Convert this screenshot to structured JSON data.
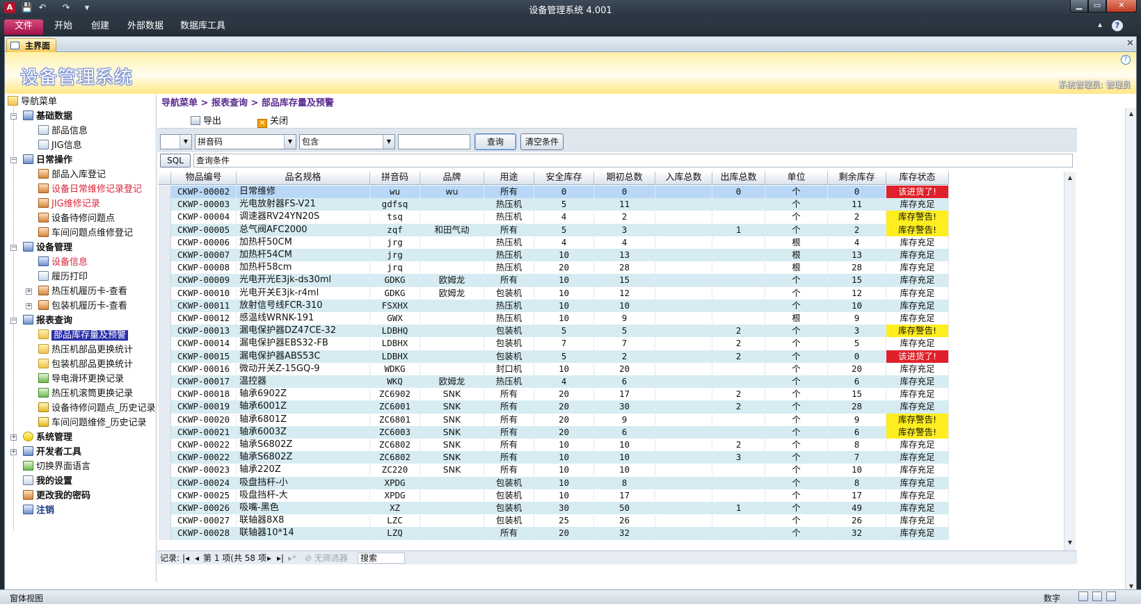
{
  "window": {
    "title": "设备管理系统 4.001",
    "min": "▁",
    "max": "▭",
    "close": "✕"
  },
  "quick_access": {
    "save": "💾",
    "undo": "↶",
    "redo": "↷",
    "more": "▾"
  },
  "ribbon": {
    "tabs": [
      "文件",
      "开始",
      "创建",
      "外部数据",
      "数据库工具"
    ],
    "help": "?",
    "caret": "▴"
  },
  "doc_tab": {
    "label": "主界面",
    "close": "✕"
  },
  "banner": {
    "app_name": "设备管理系统",
    "user": "系统管理员: 管理员",
    "help": "?"
  },
  "nav": {
    "root": "导航菜单",
    "groups": [
      {
        "label": "基础数据",
        "items": [
          "部品信息",
          "JIG信息"
        ]
      },
      {
        "label": "日常操作",
        "items": [
          "部品入库登记",
          "设备日常维修记录登记",
          "JIG维修记录",
          "设备待修问题点",
          "车间问题点维修登记"
        ]
      },
      {
        "label": "设备管理",
        "items": [
          "设备信息",
          "履历打印",
          "热压机履历卡-查看",
          "包装机履历卡-查看"
        ]
      },
      {
        "label": "报表查询",
        "items": [
          "部品库存量及预警",
          "热压机部品更换统计",
          "包装机部品更换统计",
          "导电滑环更换记录",
          "热压机滚筒更换记录",
          "设备待修问题点_历史记录",
          "车间问题维修_历史记录"
        ]
      }
    ],
    "bottom": [
      "系统管理",
      "开发者工具",
      "切换界面语言",
      "我的设置",
      "更改我的密码",
      "注销"
    ]
  },
  "breadcrumb": "导航菜单 > 报表查询 > 部品库存量及预警",
  "toolbar": {
    "export": "导出",
    "close": "关闭"
  },
  "filter": {
    "field1": "",
    "field2": "拼音码",
    "op": "包含",
    "value": "",
    "query": "查询",
    "clear": "清空条件"
  },
  "sql": {
    "button": "SQL",
    "condition": "查询条件"
  },
  "grid": {
    "columns": [
      "物品编号",
      "品名规格",
      "拼音码",
      "品牌",
      "用途",
      "安全库存",
      "期初总数",
      "入库总数",
      "出库总数",
      "单位",
      "剩余库存",
      "库存状态"
    ],
    "rows": [
      [
        "CKWP-00002",
        "日常维修",
        "wu",
        "wu",
        "所有",
        "0",
        "0",
        "",
        "0",
        "个",
        "0",
        "该进货了!"
      ],
      [
        "CKWP-00003",
        "光电放射器FS-V21",
        "gdfsq",
        "",
        "热压机",
        "5",
        "11",
        "",
        "",
        "个",
        "11",
        "库存充足"
      ],
      [
        "CKWP-00004",
        "调速器RV24YN20S",
        "tsq",
        "",
        "热压机",
        "4",
        "2",
        "",
        "",
        "个",
        "2",
        "库存警告!"
      ],
      [
        "CKWP-00005",
        "总气阀AFC2000",
        "zqf",
        "和田气动",
        "所有",
        "5",
        "3",
        "",
        "1",
        "个",
        "2",
        "库存警告!"
      ],
      [
        "CKWP-00006",
        "加热杆50CM",
        "jrg",
        "",
        "热压机",
        "4",
        "4",
        "",
        "",
        "根",
        "4",
        "库存充足"
      ],
      [
        "CKWP-00007",
        "加热杆54CM",
        "jrg",
        "",
        "热压机",
        "10",
        "13",
        "",
        "",
        "根",
        "13",
        "库存充足"
      ],
      [
        "CKWP-00008",
        "加热杆58cm",
        "jrq",
        "",
        "热压机",
        "20",
        "28",
        "",
        "",
        "根",
        "28",
        "库存充足"
      ],
      [
        "CKWP-00009",
        "光电开光E3jk-ds30ml",
        "GDKG",
        "欧姆龙",
        "所有",
        "10",
        "15",
        "",
        "",
        "个",
        "15",
        "库存充足"
      ],
      [
        "CKWP-00010",
        "光电开关E3jk-r4ml",
        "GDKG",
        "欧姆龙",
        "包装机",
        "10",
        "12",
        "",
        "",
        "个",
        "12",
        "库存充足"
      ],
      [
        "CKWP-00011",
        "放射信号线FCR-310",
        "FSXHX",
        "",
        "热压机",
        "10",
        "10",
        "",
        "",
        "个",
        "10",
        "库存充足"
      ],
      [
        "CKWP-00012",
        "感温线WRNK-191",
        "GWX",
        "",
        "热压机",
        "10",
        "9",
        "",
        "",
        "根",
        "9",
        "库存充足"
      ],
      [
        "CKWP-00013",
        "漏电保护器DZ47CE-32",
        "LDBHQ",
        "",
        "包装机",
        "5",
        "5",
        "",
        "2",
        "个",
        "3",
        "库存警告!"
      ],
      [
        "CKWP-00014",
        "漏电保护器EBS32-FB",
        "LDBHX",
        "",
        "包装机",
        "7",
        "7",
        "",
        "2",
        "个",
        "5",
        "库存充足"
      ],
      [
        "CKWP-00015",
        "漏电保护器ABS53C",
        "LDBHX",
        "",
        "包装机",
        "5",
        "2",
        "",
        "2",
        "个",
        "0",
        "该进货了!"
      ],
      [
        "CKWP-00016",
        "微动开关Z-15GQ-9",
        "WDKG",
        "",
        "封口机",
        "10",
        "20",
        "",
        "",
        "个",
        "20",
        "库存充足"
      ],
      [
        "CKWP-00017",
        "温控器",
        "WKQ",
        "欧姆龙",
        "热压机",
        "4",
        "6",
        "",
        "",
        "个",
        "6",
        "库存充足"
      ],
      [
        "CKWP-00018",
        "轴承6902Z",
        "ZC6902",
        "SNK",
        "所有",
        "20",
        "17",
        "",
        "2",
        "个",
        "15",
        "库存充足"
      ],
      [
        "CKWP-00019",
        "轴承6001Z",
        "ZC6001",
        "SNK",
        "所有",
        "20",
        "30",
        "",
        "2",
        "个",
        "28",
        "库存充足"
      ],
      [
        "CKWP-00020",
        "轴承6801Z",
        "ZC6801",
        "SNK",
        "所有",
        "20",
        "9",
        "",
        "",
        "个",
        "9",
        "库存警告!"
      ],
      [
        "CKWP-00021",
        "轴承6003Z",
        "ZC6003",
        "SNK",
        "所有",
        "20",
        "6",
        "",
        "",
        "个",
        "6",
        "库存警告!"
      ],
      [
        "CKWP-00022",
        "轴承S6802Z",
        "ZC6802",
        "SNK",
        "所有",
        "10",
        "10",
        "",
        "2",
        "个",
        "8",
        "库存充足"
      ],
      [
        "CKWP-00022",
        "轴承S6802Z",
        "ZC6802",
        "SNK",
        "所有",
        "10",
        "10",
        "",
        "3",
        "个",
        "7",
        "库存充足"
      ],
      [
        "CKWP-00023",
        "轴承220Z",
        "ZC220",
        "SNK",
        "所有",
        "10",
        "10",
        "",
        "",
        "个",
        "10",
        "库存充足"
      ],
      [
        "CKWP-00024",
        "吸盘挡杆-小",
        "XPDG",
        "",
        "包装机",
        "10",
        "8",
        "",
        "",
        "个",
        "8",
        "库存充足"
      ],
      [
        "CKWP-00025",
        "吸盘挡杆-大",
        "XPDG",
        "",
        "包装机",
        "10",
        "17",
        "",
        "",
        "个",
        "17",
        "库存充足"
      ],
      [
        "CKWP-00026",
        "吸嘴-黑色",
        "XZ",
        "",
        "包装机",
        "30",
        "50",
        "",
        "1",
        "个",
        "49",
        "库存充足"
      ],
      [
        "CKWP-00027",
        "联轴器8X8",
        "LZC",
        "",
        "包装机",
        "25",
        "26",
        "",
        "",
        "个",
        "26",
        "库存充足"
      ],
      [
        "CKWP-00028",
        "联轴器10*14",
        "LZQ",
        "",
        "所有",
        "20",
        "32",
        "",
        "",
        "个",
        "32",
        "库存充足"
      ]
    ]
  },
  "record_nav": {
    "label": "记录:",
    "first": "|◂",
    "prev": "◂",
    "position": "第 1 项(共 58 项",
    "next": "▸",
    "last": "▸|",
    "new": "▸*",
    "filter": "无筛选器",
    "search": "搜索"
  },
  "status": {
    "left": "窗体视图",
    "right": "数字"
  },
  "colors": {
    "red_status": "#e0202a",
    "yellow_status": "#ffee1f",
    "row_alt": "#d6ecf2",
    "accent": "#a3124a"
  }
}
